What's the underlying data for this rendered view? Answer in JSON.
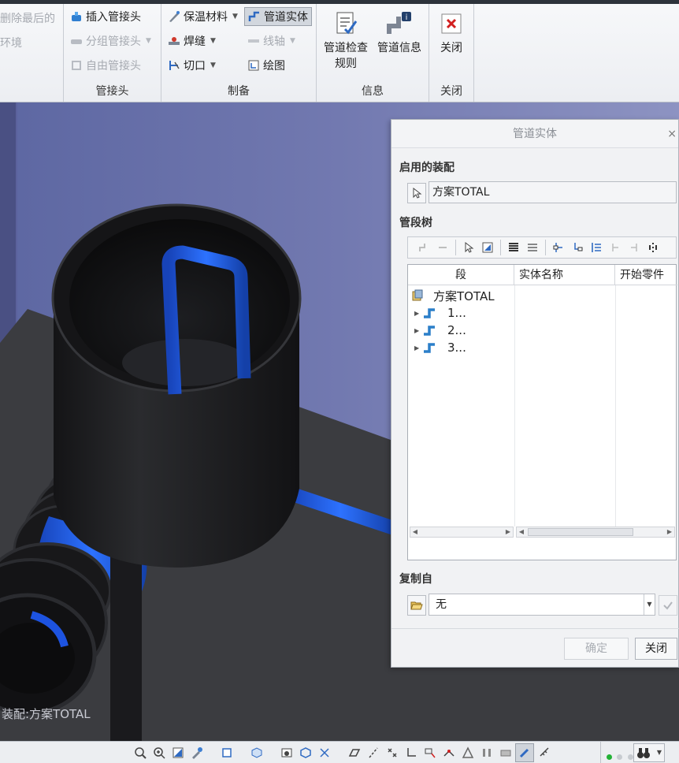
{
  "ribbon": {
    "env_group": {
      "undo_last": "删除最后的",
      "environment": "环境"
    },
    "fittings_group": {
      "label": "管接头",
      "insert_fitting": "插入管接头",
      "group_fitting": "分组管接头",
      "free_fitting": "自由管接头"
    },
    "fabrication_group": {
      "label": "制备",
      "insulation": "保温材料",
      "pipe_solid": "管道实体",
      "weld": "焊缝",
      "axis": "线轴",
      "cut": "切口",
      "drawing": "绘图"
    },
    "info_group": {
      "label": "信息",
      "check_rules_line1": "管道检查",
      "check_rules_line2": "规则",
      "pipe_info": "管道信息"
    },
    "close_group": {
      "label": "关闭",
      "close": "关闭"
    }
  },
  "viewport": {
    "assembly_label": "装配:方案TOTAL"
  },
  "dialog": {
    "title": "管道实体",
    "close_glyph": "×",
    "active_assembly_label": "启用的装配",
    "active_assembly_value": "方案TOTAL",
    "segment_tree_label": "管段树",
    "columns": [
      "段",
      "实体名称",
      "开始零件"
    ],
    "tree_root": "方案TOTAL",
    "tree_children": [
      "1...",
      "2...",
      "3..."
    ],
    "copy_from_label": "复制自",
    "copy_from_value": "无",
    "ok_button": "确定",
    "close_button": "关闭"
  },
  "colors": {
    "pipe_blue": "#1f63f0",
    "viewport_bg": "#6b72ab",
    "floor": "#3b3c40",
    "close_red": "#d21f1f"
  }
}
